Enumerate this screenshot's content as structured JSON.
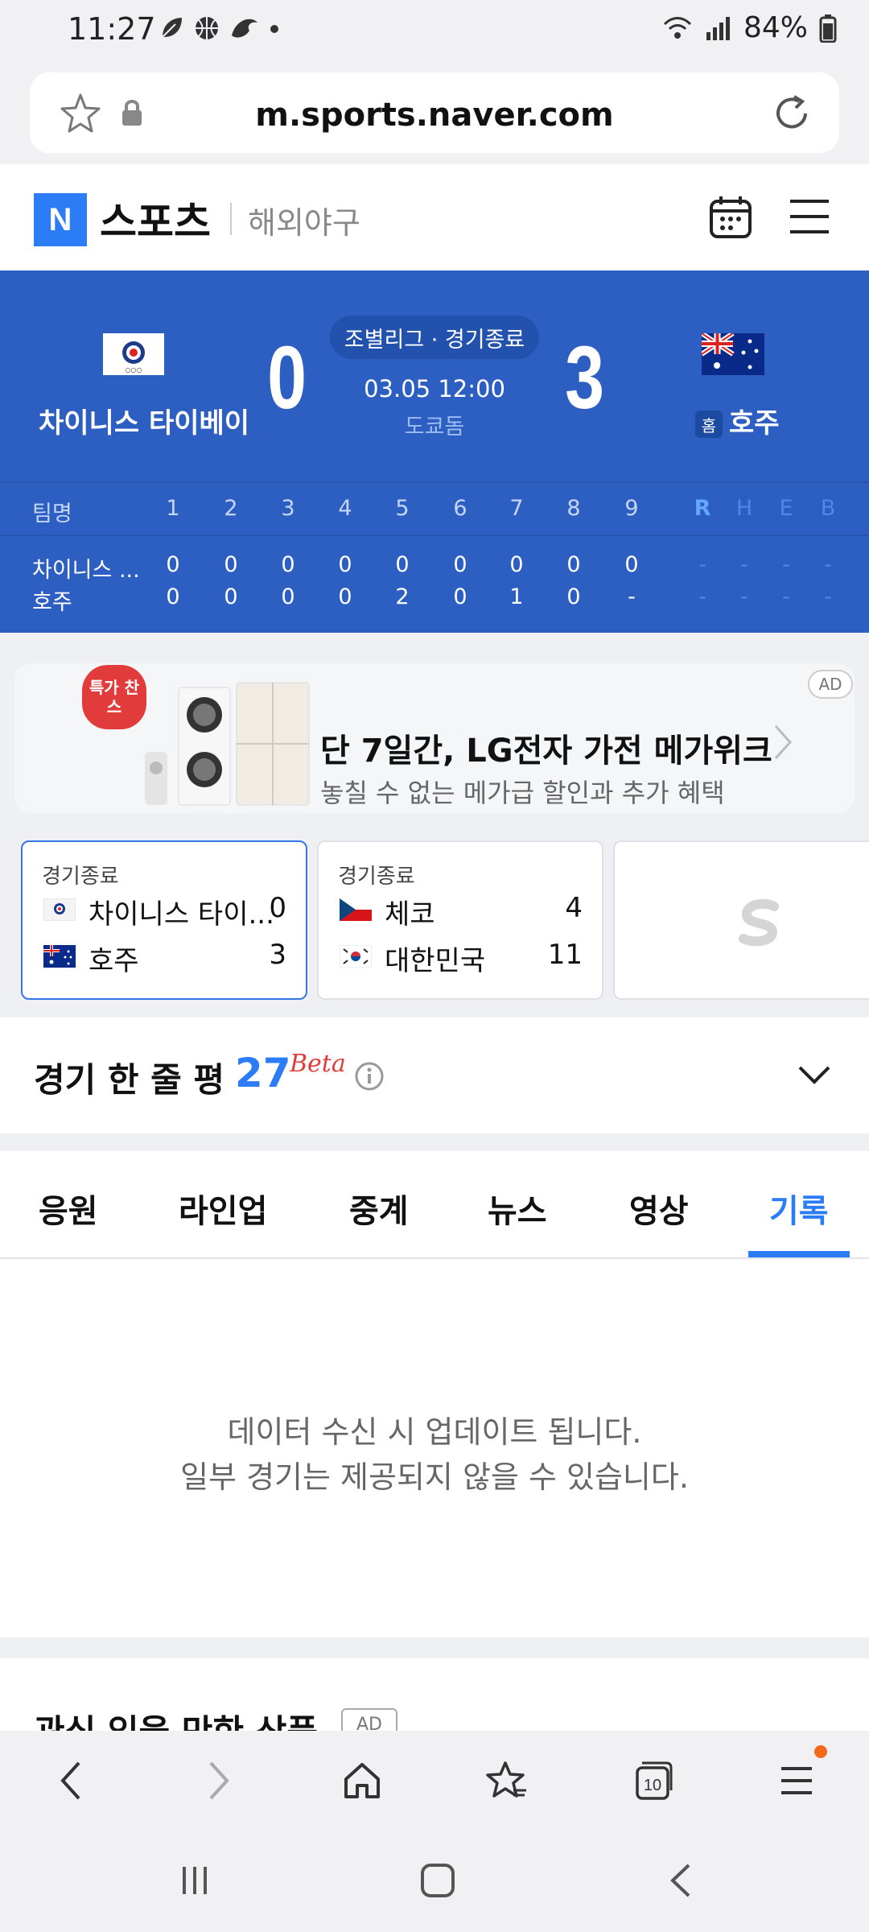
{
  "status_bar": {
    "time": "11:27",
    "battery": "84%"
  },
  "browser": {
    "url": "m.sports.naver.com",
    "tab_count": "10"
  },
  "header": {
    "logo": "N",
    "brand": "스포츠",
    "section": "해외야구"
  },
  "game": {
    "away_team": "차이니스 타이베이",
    "home_team": "호주",
    "away_score": "0",
    "home_score": "3",
    "status": "조별리그 · 경기종료",
    "datetime": "03.05 12:00",
    "venue": "도쿄돔",
    "home_label": "홈"
  },
  "linescore": {
    "header": [
      "팀명",
      "1",
      "2",
      "3",
      "4",
      "5",
      "6",
      "7",
      "8",
      "9",
      "R",
      "H",
      "E",
      "B"
    ],
    "rows": [
      {
        "team": "차이니스 ...",
        "innings": [
          "0",
          "0",
          "0",
          "0",
          "0",
          "0",
          "0",
          "0",
          "0"
        ],
        "rheb": [
          "-",
          "-",
          "-",
          "-"
        ]
      },
      {
        "team": "호주",
        "innings": [
          "0",
          "0",
          "0",
          "0",
          "2",
          "0",
          "1",
          "0",
          "-"
        ],
        "rheb": [
          "-",
          "-",
          "-",
          "-"
        ]
      }
    ]
  },
  "ad": {
    "badge": "AD",
    "burst": "특가 찬스",
    "title": "단 7일간, LG전자 가전 메가위크",
    "subtitle": "놓칠 수 없는 메가급 할인과 추가 혜택"
  },
  "game_cards": [
    {
      "status": "경기종료",
      "teams": [
        {
          "name": "차이니스 타이...",
          "score": "0"
        },
        {
          "name": "호주",
          "score": "3"
        }
      ]
    },
    {
      "status": "경기종료",
      "teams": [
        {
          "name": "체코",
          "score": "4"
        },
        {
          "name": "대한민국",
          "score": "11"
        }
      ]
    }
  ],
  "one_liner": {
    "title": "경기 한 줄 평",
    "count": "27",
    "beta": "Beta"
  },
  "tabs": [
    "응원",
    "라인업",
    "중계",
    "뉴스",
    "영상",
    "기록"
  ],
  "active_tab": "기록",
  "empty_message": {
    "line1": "데이터 수신 시 업데이트 됩니다.",
    "line2": "일부 경기는 제공되지 않을 수 있습니다."
  },
  "next_section": {
    "title": "관심 있을 만한 상품",
    "badge": "AD"
  },
  "colors": {
    "score_bg": "#2d5fc2",
    "accent": "#2b7cf5",
    "rheb": "#63a7ff"
  }
}
